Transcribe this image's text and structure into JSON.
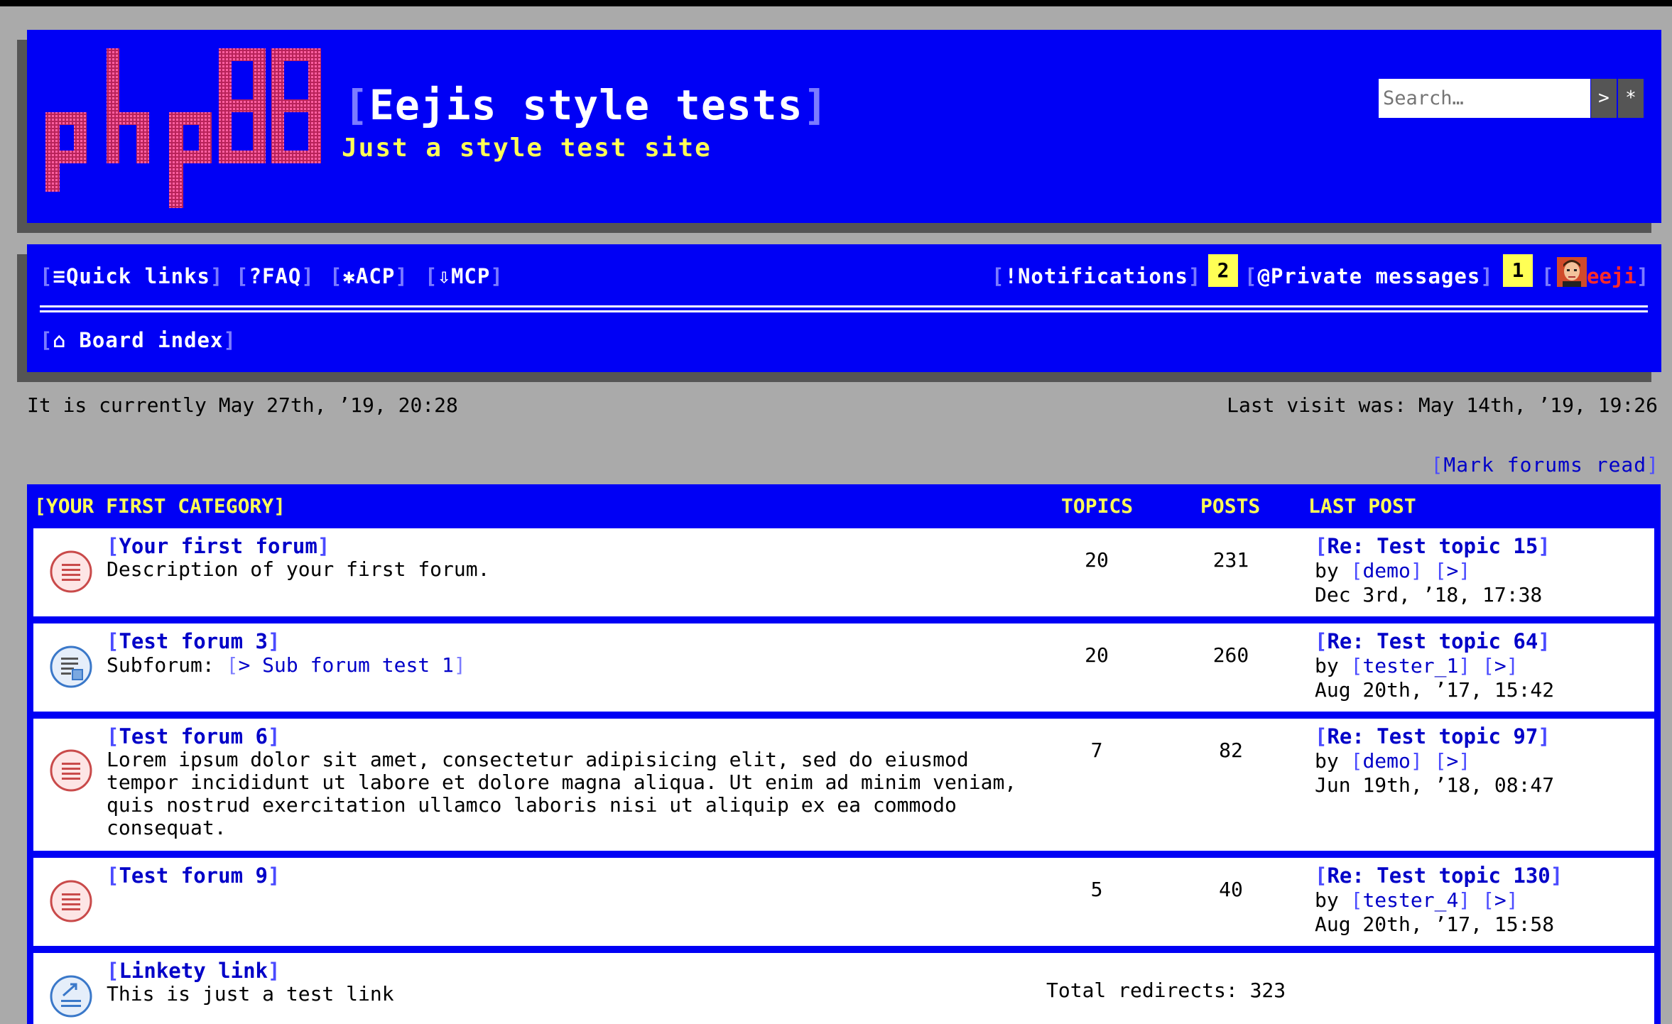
{
  "header": {
    "logo_text": "phpBB",
    "site_title": "Eejis style tests",
    "site_description": "Just a style test site",
    "search_placeholder": "Search…",
    "search_go": ">",
    "search_advanced": "*"
  },
  "nav": {
    "quick_links": "Quick links",
    "faq": "FAQ",
    "acp": "ACP",
    "mcp": "MCP",
    "notifications": "Notifications",
    "notifications_count": "2",
    "private_messages": "Private messages",
    "private_messages_count": "1",
    "username": "eeji",
    "board_index": "Board index"
  },
  "info": {
    "current_time": "It is currently May 27th, ’19, 20:28",
    "last_visit": "Last visit was: May 14th, ’19, 19:26",
    "mark_forums_read": "Mark forums read"
  },
  "category": {
    "name": "YOUR FIRST CATEGORY",
    "col_topics": "TOPICS",
    "col_posts": "POSTS",
    "col_last_post": "LAST POST",
    "forums": [
      {
        "title": "Your first forum",
        "description": "Description of your first forum.",
        "topics": "20",
        "posts": "231",
        "last_post_title": "Re: Test topic 15",
        "by": "by",
        "last_post_user": "demo",
        "goto": ">",
        "last_post_date": "Dec 3rd, ’18, 17:38"
      },
      {
        "title": "Test forum 3",
        "subforum_label": "Subforum:",
        "subforum_name": "> Sub forum test 1",
        "topics": "20",
        "posts": "260",
        "last_post_title": "Re: Test topic 64",
        "by": "by",
        "last_post_user": "tester_1",
        "goto": ">",
        "last_post_date": "Aug 20th, ’17, 15:42"
      },
      {
        "title": "Test forum 6",
        "description": "Lorem ipsum dolor sit amet, consectetur adipisicing elit, sed do eiusmod tempor incididunt ut labore et dolore magna aliqua. Ut enim ad minim veniam, quis nostrud exercitation ullamco laboris nisi ut aliquip ex ea commodo consequat.",
        "topics": "7",
        "posts": "82",
        "last_post_title": "Re: Test topic 97",
        "by": "by",
        "last_post_user": "demo",
        "goto": ">",
        "last_post_date": "Jun 19th, ’18, 08:47"
      },
      {
        "title": "Test forum 9",
        "topics": "5",
        "posts": "40",
        "last_post_title": "Re: Test topic 130",
        "by": "by",
        "last_post_user": "tester_4",
        "goto": ">",
        "last_post_date": "Aug 20th, ’17, 15:58"
      }
    ],
    "link": {
      "title": "Linkety link",
      "description": "This is just a test link",
      "redirects": "Total redirects: 323"
    }
  },
  "colors": {
    "block_blue": "#0000f5",
    "background": "#aaaaaa",
    "accent_yellow": "#ffff55",
    "link_blue": "#0000c8",
    "user_red": "#ff2a2a"
  }
}
